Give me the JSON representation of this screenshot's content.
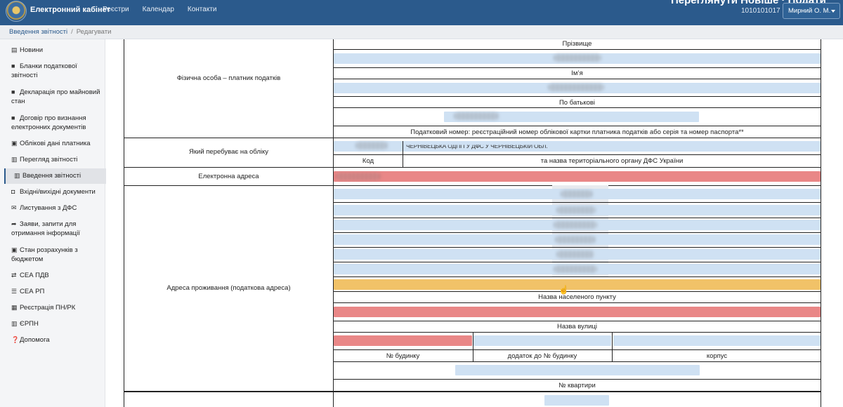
{
  "navbar": {
    "brand": "Електронний кабінет",
    "links": [
      "Реєстри",
      "Календар",
      "Контакти"
    ],
    "promo_text": "Переглянути Новіше · Подати",
    "tax_number": "1010101017",
    "user_name": "Мирний О. М."
  },
  "breadcrumb": {
    "section": "Введення звітності",
    "current": "Редагувати"
  },
  "sidebar": {
    "items": [
      {
        "icon": "news-icon",
        "label": "Новини"
      },
      {
        "icon": "file-icon",
        "label": "Бланки податкової звітності"
      },
      {
        "icon": "file-icon",
        "label": "Декларація про майновий стан"
      },
      {
        "icon": "file-icon",
        "label": "Договір про визнання електронних документів"
      },
      {
        "icon": "id-card-icon",
        "label": "Облікові дані платника"
      },
      {
        "icon": "document-icon",
        "label": "Перегляд звітності"
      },
      {
        "icon": "edit-icon",
        "label": "Введення звітності"
      },
      {
        "icon": "inbox-icon",
        "label": "Вхідні/вихідні документи"
      },
      {
        "icon": "envelope-icon",
        "label": "Листування з ДФС"
      },
      {
        "icon": "share-icon",
        "label": "Заяви, запити для отримання інформації"
      },
      {
        "icon": "money-icon",
        "label": "Стан розрахунків з бюджетом"
      },
      {
        "icon": "exchange-icon",
        "label": "СЕА ПДВ"
      },
      {
        "icon": "list-icon",
        "label": "СЕА РП"
      },
      {
        "icon": "register-icon",
        "label": "Реєстрація ПН/РК"
      },
      {
        "icon": "barcode-icon",
        "label": "ЄРПН"
      },
      {
        "icon": "question-icon",
        "label": "Допомога"
      }
    ],
    "active_index": 6
  },
  "form": {
    "person_section": "Фізична особа – платник податків",
    "surname": "Прізвище",
    "first_name": "Ім’я",
    "patronymic": "По батькові",
    "tax_id_caption": "Податковий номер: реєстраційний номер облікової картки платника податків або серія та номер паспорта**",
    "registered_section": "Який перебуває на обліку",
    "authority_value": "ЧЕРНІВЕЦЬКА ОДПІ ГУ ДФС У ЧЕРНІВЕЦЬКІЙ ОБЛ.",
    "code_caption": "Код",
    "authority_caption": "та назва територіального органу ДФС України",
    "email_section": "Електронна адреса",
    "address_section": "Адреса проживання (податкова адреса)",
    "settlement_caption": "Назва населеного пункту",
    "street_caption": "Назва вулиці",
    "house_caption": "№ будинку",
    "house_suffix_caption": "додаток до № будинку",
    "building_caption": "корпус",
    "apartment_caption": "№ квартири"
  },
  "colors": {
    "navbar": "#2b5a8c",
    "field_blue": "#cfe1f3",
    "field_required": "#e98787",
    "field_active": "#f1c268"
  }
}
